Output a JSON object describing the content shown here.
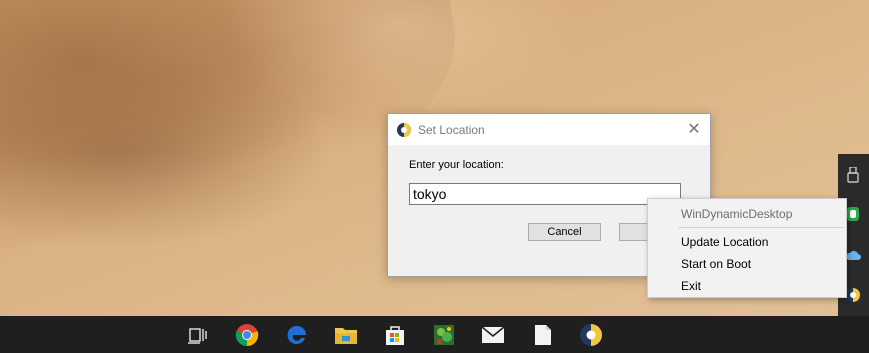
{
  "dialog": {
    "title": "Set Location",
    "prompt": "Enter your location:",
    "location_value": "tokyo",
    "cancel_label": "Cancel",
    "ok_label": "",
    "close_glyph": "✕"
  },
  "context_menu": {
    "header": "WinDynamicDesktop",
    "items": [
      {
        "label": "Update Location"
      },
      {
        "label": "Start on Boot"
      },
      {
        "label": "Exit"
      }
    ]
  },
  "tray_icons": [
    "usb-eject-icon",
    "green-drive-icon",
    "onedrive-cloud-icon",
    "windynamicdesktop-icon"
  ],
  "taskbar_icons": [
    "task-view-icon",
    "chrome-icon",
    "edge-icon",
    "file-explorer-icon",
    "store-icon",
    "game-icon",
    "mail-icon",
    "document-icon",
    "windynamicdesktop-icon"
  ],
  "colors": {
    "taskbar": "#1f1f1f",
    "dialog_bg": "#f0f0f0",
    "menu_bg": "#f2f2f2",
    "edge_blue": "#1e6fd6",
    "explorer_yellow": "#f2c744"
  }
}
